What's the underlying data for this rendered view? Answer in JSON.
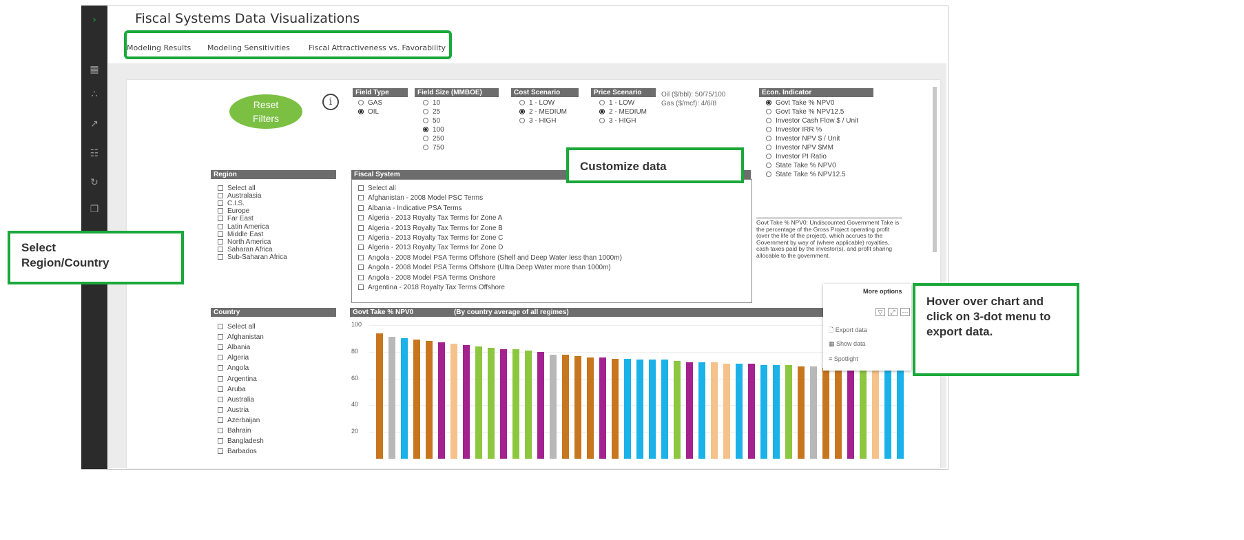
{
  "app": {
    "title": "Fiscal Systems Data Visualizations"
  },
  "tabs": [
    {
      "label": "Modeling Results"
    },
    {
      "label": "Modeling Sensitivities"
    },
    {
      "label": "Fiscal Attractiveness vs. Favorability"
    }
  ],
  "reset": {
    "line1": "Reset",
    "line2": "Filters"
  },
  "field_type": {
    "title": "Field Type",
    "options": [
      {
        "label": "GAS",
        "selected": false
      },
      {
        "label": "OIL",
        "selected": true
      }
    ]
  },
  "field_size": {
    "title": "Field Size (MMBOE)",
    "options": [
      {
        "label": "10",
        "selected": false
      },
      {
        "label": "25",
        "selected": false
      },
      {
        "label": "50",
        "selected": false
      },
      {
        "label": "100",
        "selected": true
      },
      {
        "label": "250",
        "selected": false
      },
      {
        "label": "750",
        "selected": false
      }
    ]
  },
  "cost_scenario": {
    "title": "Cost Scenario",
    "options": [
      {
        "label": "1 - LOW",
        "selected": false
      },
      {
        "label": "2 - MEDIUM",
        "selected": true
      },
      {
        "label": "3 - HIGH",
        "selected": false
      }
    ]
  },
  "price_scenario": {
    "title": "Price Scenario",
    "options": [
      {
        "label": "1 - LOW",
        "selected": false
      },
      {
        "label": "2 - MEDIUM",
        "selected": true
      },
      {
        "label": "3 - HIGH",
        "selected": false
      }
    ],
    "note1": "Oil ($/bbl): 50/75/100",
    "note2": "Gas ($/mcf): 4/6/8"
  },
  "econ": {
    "title": "Econ. Indicator",
    "options": [
      {
        "label": "Govt Take % NPV0",
        "selected": true
      },
      {
        "label": "Govt Take % NPV12.5",
        "selected": false
      },
      {
        "label": "Investor Cash Flow $ / Unit",
        "selected": false
      },
      {
        "label": "Investor IRR %",
        "selected": false
      },
      {
        "label": "Investor NPV $ / Unit",
        "selected": false
      },
      {
        "label": "Investor NPV $MM",
        "selected": false
      },
      {
        "label": "Investor PI Ratio",
        "selected": false
      },
      {
        "label": "State Take % NPV0",
        "selected": false
      },
      {
        "label": "State Take % NPV12.5",
        "selected": false
      }
    ],
    "description": "Govt Take % NPV0: Undiscounted Government Take is the percentage of the Gross Project operating profit (over the life of the project), which accrues to the Government by way of (where applicable) royalties, cash taxes paid by the investor(s), and profit sharing allocable to the government."
  },
  "region": {
    "title": "Region",
    "items": [
      "Select all",
      "Australasia",
      "C.I.S.",
      "Europe",
      "Far East",
      "Latin America",
      "Middle East",
      "North America",
      "Saharan Africa",
      "Sub-Saharan Africa"
    ]
  },
  "fiscal": {
    "title": "Fiscal System",
    "items": [
      "Select all",
      "Afghanistan - 2008 Model PSC Terms",
      "Albania - Indicative PSA Terms",
      "Algeria - 2013 Royalty Tax Terms for Zone A",
      "Algeria - 2013 Royalty Tax Terms for Zone B",
      "Algeria - 2013 Royalty Tax Terms for Zone C",
      "Algeria - 2013 Royalty Tax Terms for Zone D",
      "Angola - 2008 Model PSA Terms Offshore (Shelf and Deep Water less than 1000m)",
      "Angola - 2008 Model PSA Terms Offshore (Ultra Deep Water more than 1000m)",
      "Angola - 2008 Model PSA Terms Onshore",
      "Argentina - 2018 Royalty Tax Terms Offshore"
    ]
  },
  "country": {
    "title": "Country",
    "items": [
      "Select all",
      "Afghanistan",
      "Albania",
      "Algeria",
      "Angola",
      "Argentina",
      "Aruba",
      "Australia",
      "Austria",
      "Azerbaijan",
      "Bahrain",
      "Bangladesh",
      "Barbados"
    ]
  },
  "chart": {
    "title": "Govt Take % NPV0",
    "subtitle": "(By country average of all regimes)"
  },
  "chart_data": {
    "type": "bar",
    "title": "Govt Take % NPV0",
    "subtitle": "(By country average of all regimes)",
    "ylim": [
      0,
      100
    ],
    "yticks": [
      20,
      40,
      60,
      80,
      100
    ],
    "values": [
      94,
      91,
      90,
      89,
      88,
      87,
      86,
      85,
      84,
      83,
      82,
      82,
      81,
      80,
      78,
      78,
      77,
      76,
      76,
      75,
      75,
      74,
      74,
      74,
      73,
      72,
      72,
      72,
      71,
      71,
      71,
      70,
      70,
      70,
      69,
      69,
      68,
      68,
      67,
      67,
      67,
      66,
      66
    ],
    "colors": [
      "#c7761f",
      "#b8b8b8",
      "#1ab2e8",
      "#c7761f",
      "#c7761f",
      "#a3228f",
      "#f4c28a",
      "#a3228f",
      "#8dc63f",
      "#8dc63f",
      "#a3228f",
      "#8dc63f",
      "#8dc63f",
      "#a3228f",
      "#b8b8b8",
      "#c7761f",
      "#c7761f",
      "#c7761f",
      "#a3228f",
      "#c7761f",
      "#1ab2e8",
      "#1ab2e8",
      "#1ab2e8",
      "#1ab2e8",
      "#8dc63f",
      "#a3228f",
      "#1ab2e8",
      "#f4c28a",
      "#f4c28a",
      "#1ab2e8",
      "#a3228f",
      "#1ab2e8",
      "#1ab2e8",
      "#8dc63f",
      "#c7761f",
      "#b8b8b8",
      "#c7761f",
      "#c7761f",
      "#a3228f",
      "#8dc63f",
      "#f4c28a",
      "#1ab2e8",
      "#1ab2e8"
    ]
  },
  "menu": {
    "title": "More options",
    "items": [
      "Export data",
      "Show data",
      "Spotlight"
    ]
  },
  "callouts": {
    "customize": "Customize data",
    "region_line1": "Select",
    "region_line2": "Region/Country",
    "export": "Hover over chart and click on 3-dot menu to export data."
  },
  "icons": {
    "rail": [
      "chevron-right-icon",
      "grid-icon",
      "scatter-icon",
      "line-chart-icon",
      "table-icon",
      "refresh-icon",
      "copy-icon"
    ]
  },
  "colors": {
    "accent_green": "#1aa83a",
    "reset_green": "#7bc043",
    "header_gray": "#6d6d6d"
  }
}
